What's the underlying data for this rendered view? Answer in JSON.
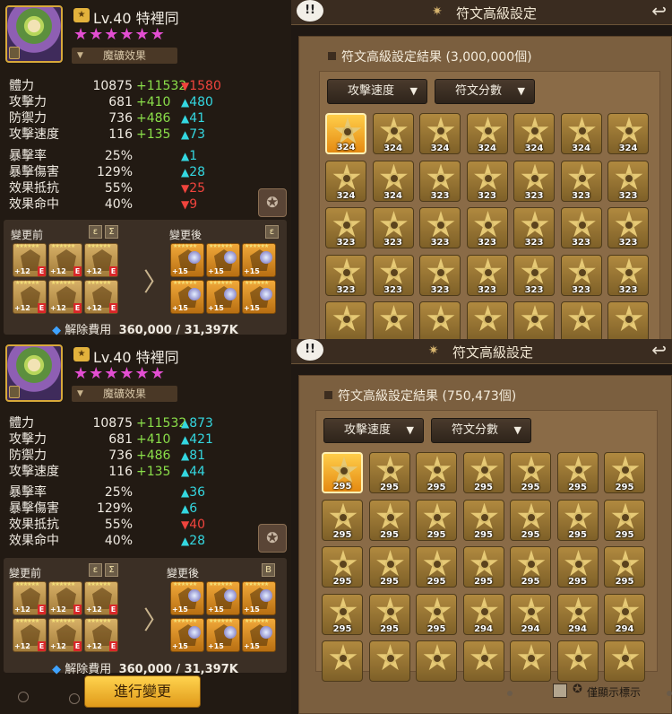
{
  "common": {
    "level_badge": "★",
    "level_name": "Lv.40 特裡同",
    "stars": "★★★★★★",
    "relic_label": "魔礦效果",
    "before_label": "變更前",
    "after_label": "變更後",
    "cost_label": "解除費用",
    "cost_value": "360,000 / 31,397K",
    "rune_stars": "★★★★★★",
    "rune_old_plus": "+12",
    "rune_new_plus": "+15",
    "rune_grade": "E",
    "header_title": "符文高級設定",
    "bubble": "!!",
    "dropdown_1": "攻擊速度",
    "dropdown_2": "符文分數",
    "chevron": "▼",
    "set_icon_violent": "ε",
    "set_icon_swift": "Σ",
    "set_icon_despair": "B"
  },
  "stat_names": [
    "體力",
    "攻擊力",
    "防禦力",
    "攻擊速度",
    "暴擊率",
    "暴擊傷害",
    "效果抵抗",
    "效果命中"
  ],
  "screen1": {
    "stats": [
      {
        "base": "10875",
        "plus": "+11532",
        "dir": "down",
        "change": "1580"
      },
      {
        "base": "681",
        "plus": "+410",
        "dir": "up",
        "change": "480"
      },
      {
        "base": "736",
        "plus": "+486",
        "dir": "up",
        "change": "41"
      },
      {
        "base": "116",
        "plus": "+135",
        "dir": "up",
        "change": "73"
      },
      {
        "base": "25%",
        "plus": "",
        "dir": "up",
        "change": "1"
      },
      {
        "base": "129%",
        "plus": "",
        "dir": "up",
        "change": "28"
      },
      {
        "base": "55%",
        "plus": "",
        "dir": "down",
        "change": "25"
      },
      {
        "base": "40%",
        "plus": "",
        "dir": "down",
        "change": "9"
      }
    ],
    "result_title": "符文高級設定結果 (3,000,000個)",
    "scores": [
      [
        "324",
        "324",
        "324",
        "324",
        "324",
        "324",
        "324"
      ],
      [
        "324",
        "324",
        "323",
        "323",
        "323",
        "323",
        "323"
      ],
      [
        "323",
        "323",
        "323",
        "323",
        "323",
        "323",
        "323"
      ],
      [
        "323",
        "323",
        "323",
        "323",
        "323",
        "323",
        "323"
      ],
      [
        "",
        "",
        "",
        "",
        "",
        "",
        ""
      ]
    ]
  },
  "screen2": {
    "stats": [
      {
        "base": "10875",
        "plus": "+11532",
        "dir": "up",
        "change": "873"
      },
      {
        "base": "681",
        "plus": "+410",
        "dir": "up",
        "change": "421"
      },
      {
        "base": "736",
        "plus": "+486",
        "dir": "up",
        "change": "81"
      },
      {
        "base": "116",
        "plus": "+135",
        "dir": "up",
        "change": "44"
      },
      {
        "base": "25%",
        "plus": "",
        "dir": "up",
        "change": "36"
      },
      {
        "base": "129%",
        "plus": "",
        "dir": "up",
        "change": "6"
      },
      {
        "base": "55%",
        "plus": "",
        "dir": "down",
        "change": "40"
      },
      {
        "base": "40%",
        "plus": "",
        "dir": "up",
        "change": "28"
      }
    ],
    "result_title": "符文高級設定結果 (750,473個)",
    "scores": [
      [
        "295",
        "295",
        "295",
        "295",
        "295",
        "295",
        "295"
      ],
      [
        "295",
        "295",
        "295",
        "295",
        "295",
        "295",
        "295"
      ],
      [
        "295",
        "295",
        "295",
        "295",
        "295",
        "295",
        "295"
      ],
      [
        "295",
        "295",
        "295",
        "294",
        "294",
        "294",
        "294"
      ],
      [
        "",
        "",
        "",
        "",
        "",
        "",
        ""
      ]
    ],
    "apply_button": "進行變更",
    "only_show_label": "僅顯示標示"
  }
}
